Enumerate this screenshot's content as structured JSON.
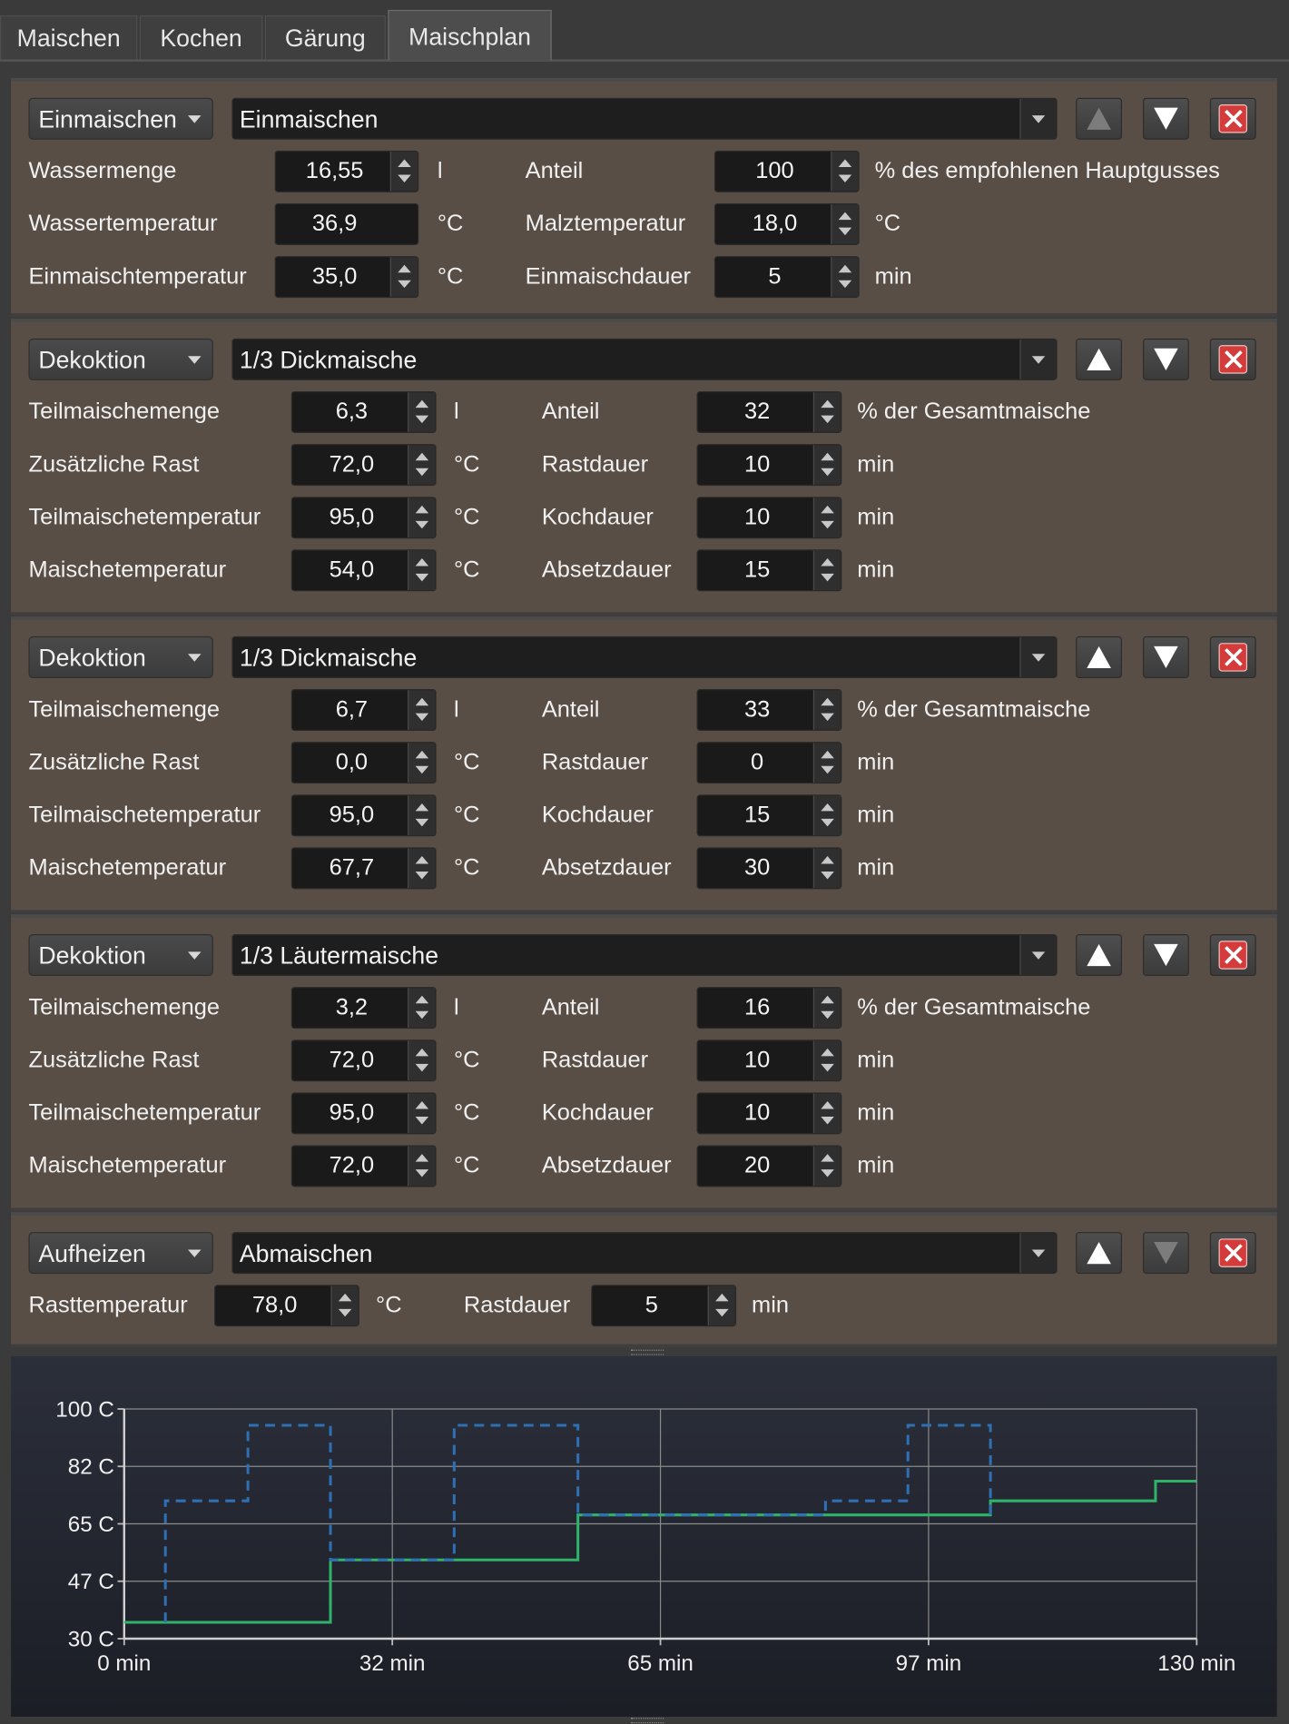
{
  "tabs": [
    "Maischen",
    "Kochen",
    "Gärung",
    "Maischplan"
  ],
  "active_tab": "Maischplan",
  "steps": [
    {
      "type": "Einmaischen",
      "name": "Einmaischen",
      "up_enabled": false,
      "down_enabled": true,
      "rows": [
        {
          "l1": "Wassermenge",
          "v1": "16,55",
          "u1": "l",
          "l2": "Anteil",
          "v2": "100",
          "u2": "% des empfohlenen Hauptgusses"
        },
        {
          "l1": "Wassertemperatur",
          "v1": "36,9",
          "u1": "°C",
          "l2": "Malztemperatur",
          "v2": "18,0",
          "u2": "°C"
        },
        {
          "l1": "Einmaischtemperatur",
          "v1": "35,0",
          "u1": "°C",
          "l2": "Einmaischdauer",
          "v2": "5",
          "u2": "min"
        }
      ]
    },
    {
      "type": "Dekoktion",
      "name": "1/3 Dickmaische",
      "up_enabled": true,
      "down_enabled": true,
      "rows": [
        {
          "l1": "Teilmaischemenge",
          "v1": "6,3",
          "u1": "l",
          "l2": "Anteil",
          "v2": "32",
          "u2": "% der Gesamtmaische"
        },
        {
          "l1": "Zusätzliche Rast",
          "v1": "72,0",
          "u1": "°C",
          "l2": "Rastdauer",
          "v2": "10",
          "u2": "min"
        },
        {
          "l1": "Teilmaischetemperatur",
          "v1": "95,0",
          "u1": "°C",
          "l2": "Kochdauer",
          "v2": "10",
          "u2": "min"
        },
        {
          "l1": "Maischetemperatur",
          "v1": "54,0",
          "u1": "°C",
          "l2": "Absetzdauer",
          "v2": "15",
          "u2": "min"
        }
      ]
    },
    {
      "type": "Dekoktion",
      "name": "1/3 Dickmaische",
      "up_enabled": true,
      "down_enabled": true,
      "rows": [
        {
          "l1": "Teilmaischemenge",
          "v1": "6,7",
          "u1": "l",
          "l2": "Anteil",
          "v2": "33",
          "u2": "% der Gesamtmaische"
        },
        {
          "l1": "Zusätzliche Rast",
          "v1": "0,0",
          "u1": "°C",
          "l2": "Rastdauer",
          "v2": "0",
          "u2": "min"
        },
        {
          "l1": "Teilmaischetemperatur",
          "v1": "95,0",
          "u1": "°C",
          "l2": "Kochdauer",
          "v2": "15",
          "u2": "min"
        },
        {
          "l1": "Maischetemperatur",
          "v1": "67,7",
          "u1": "°C",
          "l2": "Absetzdauer",
          "v2": "30",
          "u2": "min"
        }
      ]
    },
    {
      "type": "Dekoktion",
      "name": "1/3 Läutermaische",
      "up_enabled": true,
      "down_enabled": true,
      "rows": [
        {
          "l1": "Teilmaischemenge",
          "v1": "3,2",
          "u1": "l",
          "l2": "Anteil",
          "v2": "16",
          "u2": "% der Gesamtmaische"
        },
        {
          "l1": "Zusätzliche Rast",
          "v1": "72,0",
          "u1": "°C",
          "l2": "Rastdauer",
          "v2": "10",
          "u2": "min"
        },
        {
          "l1": "Teilmaischetemperatur",
          "v1": "95,0",
          "u1": "°C",
          "l2": "Kochdauer",
          "v2": "10",
          "u2": "min"
        },
        {
          "l1": "Maischetemperatur",
          "v1": "72,0",
          "u1": "°C",
          "l2": "Absetzdauer",
          "v2": "20",
          "u2": "min"
        }
      ]
    },
    {
      "type": "Aufheizen",
      "name": "Abmaischen",
      "up_enabled": true,
      "down_enabled": false,
      "rows": [
        {
          "l1": "Rasttemperatur",
          "v1": "78,0",
          "u1": "°C",
          "l2": "Rastdauer",
          "v2": "5",
          "u2": "min"
        }
      ]
    }
  ],
  "colors": {
    "panel_bg": "#594e46",
    "main_mash_line": "#2fb36a",
    "decoction_line": "#2f6fb3"
  },
  "chart_data": {
    "type": "line",
    "x_ticks": [
      "0 min",
      "32 min",
      "65 min",
      "97 min",
      "130 min"
    ],
    "y_ticks": [
      "100 C",
      "82 C",
      "65 C",
      "47 C",
      "30 C"
    ],
    "xlim": [
      0,
      130
    ],
    "ylim": [
      30,
      100
    ],
    "grid": true,
    "series": [
      {
        "style": "solid",
        "color": "#2fb36a",
        "points": [
          [
            0,
            35
          ],
          [
            25,
            35
          ],
          [
            25,
            54
          ],
          [
            55,
            54
          ],
          [
            55,
            67.7
          ],
          [
            105,
            67.7
          ],
          [
            105,
            72
          ],
          [
            125,
            72
          ],
          [
            125,
            78
          ],
          [
            130,
            78
          ]
        ]
      },
      {
        "style": "dashed",
        "color": "#2f6fb3",
        "points": [
          [
            5,
            35
          ],
          [
            5,
            72
          ],
          [
            15,
            72
          ],
          [
            15,
            95
          ],
          [
            25,
            95
          ],
          [
            25,
            54
          ],
          [
            40,
            54
          ],
          [
            40,
            95
          ],
          [
            55,
            95
          ],
          [
            55,
            67.7
          ],
          [
            85,
            67.7
          ],
          [
            85,
            72
          ],
          [
            95,
            72
          ],
          [
            95,
            95
          ],
          [
            105,
            95
          ],
          [
            105,
            67.7
          ]
        ]
      }
    ]
  }
}
